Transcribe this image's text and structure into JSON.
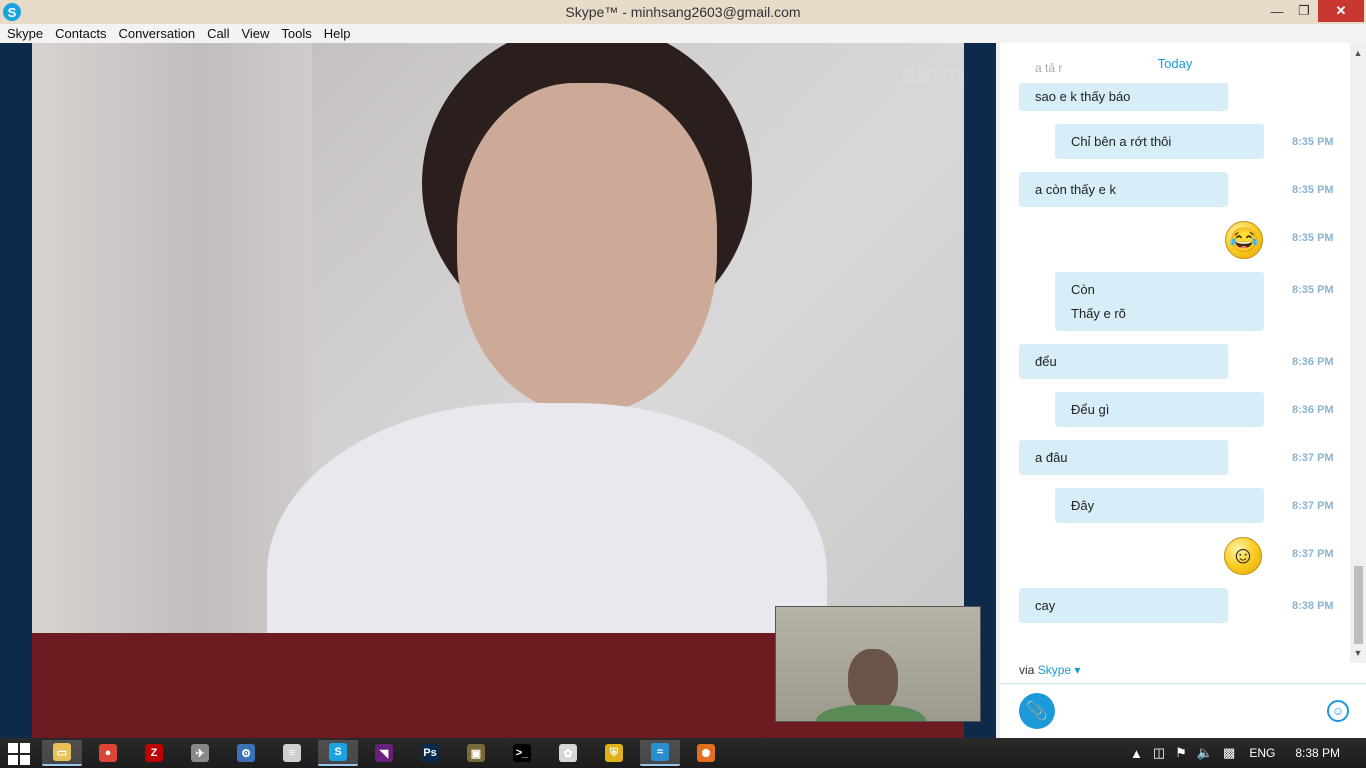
{
  "window": {
    "title": "Skype™ - minhsang2603@gmail.com",
    "app_icon_glyph": "S",
    "minimize": "—",
    "maximize": "❐",
    "close": "✕"
  },
  "menu": [
    "Skype",
    "Contacts",
    "Conversation",
    "Call",
    "View",
    "Tools",
    "Help"
  ],
  "video": {
    "watermark": "skype"
  },
  "chat": {
    "date_header": "Today",
    "faded_top": "a tả r",
    "messages": [
      {
        "dir": "in",
        "lines": [
          "sao e k thấy báo"
        ],
        "time": ""
      },
      {
        "dir": "out",
        "lines": [
          "Chỉ bên a rớt thôi"
        ],
        "time": "8:35 PM"
      },
      {
        "dir": "in",
        "lines": [
          "a còn thấy e k"
        ],
        "time": "8:35 PM"
      },
      {
        "dir": "emoji",
        "emoji": "laughing-emoji",
        "glyph": "😂",
        "time": "8:35 PM"
      },
      {
        "dir": "out",
        "lines": [
          "Còn",
          "Thấy e rõ"
        ],
        "time": "8:35 PM"
      },
      {
        "dir": "in",
        "lines": [
          "đểu"
        ],
        "time": "8:36 PM"
      },
      {
        "dir": "out",
        "lines": [
          "Đểu gì"
        ],
        "time": "8:36 PM"
      },
      {
        "dir": "in",
        "lines": [
          "a đâu"
        ],
        "time": "8:37 PM"
      },
      {
        "dir": "out",
        "lines": [
          "Đây"
        ],
        "time": "8:37 PM"
      },
      {
        "dir": "emoji",
        "emoji": "smile-emoji",
        "glyph": "☺",
        "time": "8:37 PM"
      },
      {
        "dir": "in",
        "lines": [
          "cay"
        ],
        "time": "8:38 PM"
      }
    ],
    "via_label": "via",
    "via_link": "Skype ▾",
    "compose_placeholder": ""
  },
  "taskbar": {
    "apps": [
      {
        "name": "file-explorer",
        "glyph": "▭",
        "color": "#e8c158"
      },
      {
        "name": "chrome",
        "glyph": "●",
        "color": "#db4437"
      },
      {
        "name": "filezilla",
        "glyph": "Z",
        "color": "#bf0000"
      },
      {
        "name": "app-bird",
        "glyph": "✈",
        "color": "#888888"
      },
      {
        "name": "app-tools",
        "glyph": "⚙",
        "color": "#3b6fb6"
      },
      {
        "name": "app-document",
        "glyph": "≡",
        "color": "#cfcfcf"
      },
      {
        "name": "skype",
        "glyph": "S",
        "color": "#1aa3e0"
      },
      {
        "name": "visual-studio",
        "glyph": "◥",
        "color": "#68217a"
      },
      {
        "name": "photoshop",
        "glyph": "Ps",
        "color": "#0a2a4a"
      },
      {
        "name": "media-player",
        "glyph": "▣",
        "color": "#7a6a3a"
      },
      {
        "name": "command-prompt",
        "glyph": ">_",
        "color": "#000000"
      },
      {
        "name": "app-paint",
        "glyph": "✿",
        "color": "#d6d6d6"
      },
      {
        "name": "security-shield",
        "glyph": "⛨",
        "color": "#e0b21a"
      },
      {
        "name": "network-app",
        "glyph": "≈",
        "color": "#2a8fd0"
      },
      {
        "name": "app-pinwheel",
        "glyph": "✺",
        "color": "#e07020"
      }
    ],
    "tray": {
      "language": "ENG",
      "time": "8:38 PM"
    }
  },
  "colors": {
    "accent": "#1b9ad9",
    "bubble": "#d7eef9",
    "titlebar": "#e6dcc9"
  }
}
